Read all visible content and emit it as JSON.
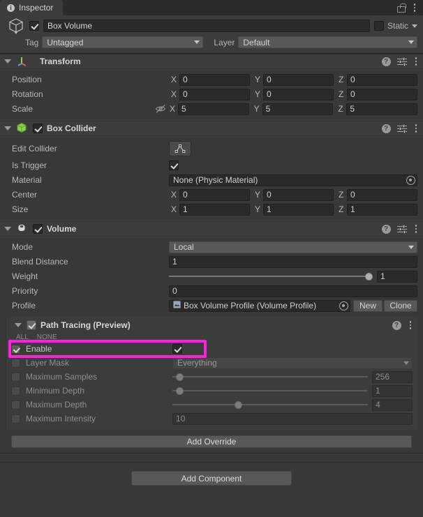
{
  "window": {
    "tab_label": "Inspector",
    "tab_icon": "info-icon",
    "lock_icon": "lock-icon",
    "menu_icon": "kebab-menu-icon"
  },
  "object_header": {
    "enabled": true,
    "name_value": "Box Volume",
    "static_label": "Static",
    "static_checked": false,
    "tag_label": "Tag",
    "tag_value": "Untagged",
    "layer_label": "Layer",
    "layer_value": "Default"
  },
  "components": [
    {
      "title": "Transform",
      "icon": "transform-axis-icon",
      "has_checkbox": false,
      "rows": [
        {
          "label": "Position",
          "axes": [
            "X",
            "Y",
            "Z"
          ],
          "values": [
            "0",
            "0",
            "0"
          ]
        },
        {
          "label": "Rotation",
          "axes": [
            "X",
            "Y",
            "Z"
          ],
          "values": [
            "0",
            "0",
            "0"
          ]
        },
        {
          "label": "Scale",
          "axes": [
            "X",
            "Y",
            "Z"
          ],
          "values": [
            "5",
            "5",
            "5"
          ],
          "lock_icon": "constrain-proportions-off-icon"
        }
      ]
    },
    {
      "title": "Box Collider",
      "icon": "box-collider-icon",
      "has_checkbox": true,
      "enabled": true,
      "edit_collider_label": "Edit Collider",
      "edit_collider_icon": "edit-collider-icon",
      "is_trigger_label": "Is Trigger",
      "is_trigger_checked": true,
      "material_label": "Material",
      "material_value": "None (Physic Material)",
      "center_label": "Center",
      "center_values": [
        "0",
        "0",
        "0"
      ],
      "size_label": "Size",
      "size_values": [
        "1",
        "1",
        "1"
      ]
    },
    {
      "title": "Volume",
      "icon": "volume-icon",
      "has_checkbox": true,
      "enabled": true,
      "mode_label": "Mode",
      "mode_value": "Local",
      "blend_label": "Blend Distance",
      "blend_value": "1",
      "weight_label": "Weight",
      "weight_value": "1",
      "weight_pct": 100,
      "priority_label": "Priority",
      "priority_value": "0",
      "profile_label": "Profile",
      "profile_value": "Box Volume Profile (Volume Profile)",
      "profile_new_label": "New",
      "profile_clone_label": "Clone"
    }
  ],
  "path_tracing": {
    "title": "Path Tracing (Preview)",
    "enabled": true,
    "all_label": "ALL",
    "none_label": "NONE",
    "help_icon": "help-icon",
    "menu_icon": "kebab-menu-icon",
    "highlight_color": "#ff22dd",
    "rows": [
      {
        "name": "enable",
        "label": "Enable",
        "override": true,
        "control": "checkbox",
        "checked": true,
        "highlighted": true
      },
      {
        "name": "layer-mask",
        "label": "Layer Mask",
        "override": false,
        "control": "dropdown",
        "value": "Everything"
      },
      {
        "name": "maximum-samples",
        "label": "Maximum Samples",
        "override": false,
        "control": "slider",
        "value": "256",
        "pct": 2
      },
      {
        "name": "minimum-depth",
        "label": "Minimum Depth",
        "override": false,
        "control": "slider",
        "value": "1",
        "pct": 2
      },
      {
        "name": "maximum-depth",
        "label": "Maximum Depth",
        "override": false,
        "control": "slider",
        "value": "4",
        "pct": 33
      },
      {
        "name": "maximum-intensity",
        "label": "Maximum Intensity",
        "override": false,
        "control": "field",
        "value": "10"
      }
    ]
  },
  "footer": {
    "add_override_label": "Add Override",
    "add_component_label": "Add Component"
  }
}
